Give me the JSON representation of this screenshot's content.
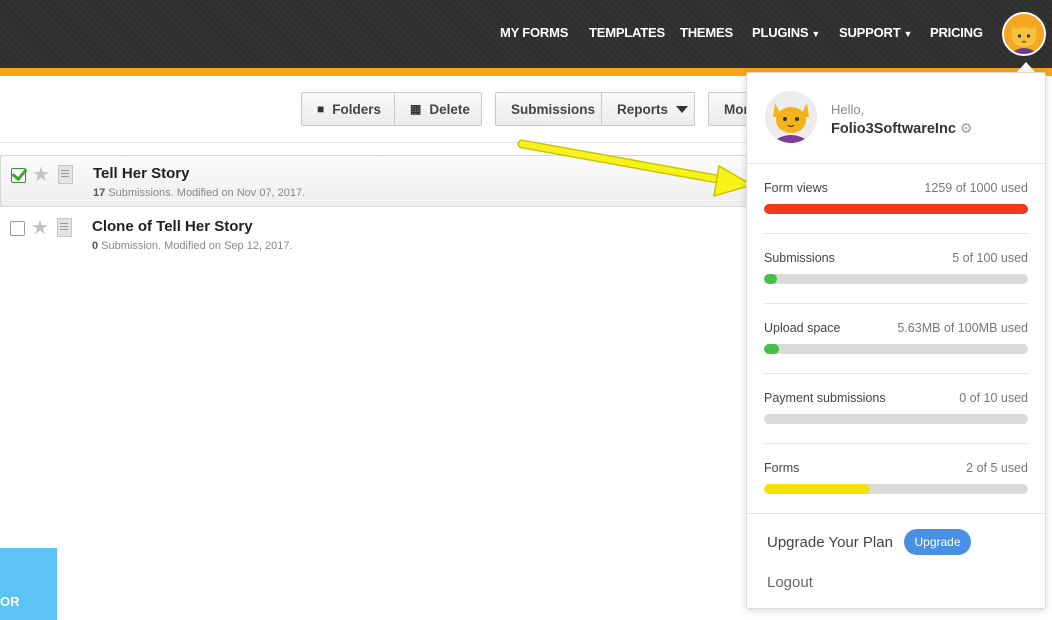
{
  "nav": {
    "items": [
      {
        "label": "MY FORMS"
      },
      {
        "label": "TEMPLATES"
      },
      {
        "label": "THEMES"
      },
      {
        "label": "PLUGINS"
      },
      {
        "label": "SUPPORT"
      },
      {
        "label": "PRICING"
      }
    ],
    "caret": "▼"
  },
  "toolbar": {
    "folders_label": "Folders",
    "delete_label": "Delete",
    "submissions_label": "Submissions",
    "reports_label": "Reports",
    "more_label": "Mor"
  },
  "forms": [
    {
      "title": "Tell Her Story",
      "count": "17",
      "meta": " Submissions. Modified on Nov 07, 2017.",
      "checked": true
    },
    {
      "title": "Clone of Tell Her Story",
      "count": "0",
      "meta": " Submission. Modified on Sep 12, 2017.",
      "checked": false
    }
  ],
  "account": {
    "greeting": "Hello,",
    "username": "Folio3SoftwareInc",
    "usage": [
      {
        "label": "Form views",
        "value": "1259 of 1000 used",
        "fraction": 1.0,
        "color": "#f0391a"
      },
      {
        "label": "Submissions",
        "value": "5 of 100 used",
        "fraction": 0.05,
        "color": "#46c046"
      },
      {
        "label": "Upload space",
        "value": "5.63MB of 100MB used",
        "fraction": 0.056,
        "color": "#46c046"
      },
      {
        "label": "Payment submissions",
        "value": "0 of 10 used",
        "fraction": 0.0,
        "color": "#46c046"
      },
      {
        "label": "Forms",
        "value": "2 of 5 used",
        "fraction": 0.4,
        "color": "#f5e10a"
      }
    ],
    "upgrade_text": "Upgrade Your Plan",
    "upgrade_button": "Upgrade",
    "logout": "Logout"
  },
  "footer": {
    "blue_label": "OR"
  }
}
